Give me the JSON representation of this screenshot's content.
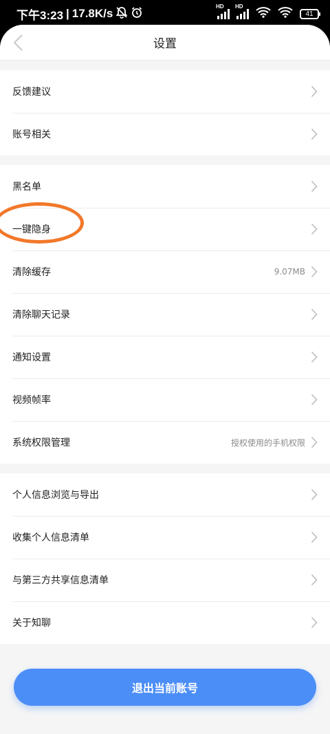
{
  "status_bar": {
    "time": "下午3:23",
    "separator": "|",
    "speed": "17.8K/s",
    "signal_badge": "HD",
    "battery": "41"
  },
  "header": {
    "title": "设置"
  },
  "groups": [
    {
      "items": [
        {
          "label": "反馈建议",
          "value": ""
        },
        {
          "label": "账号相关",
          "value": ""
        }
      ]
    },
    {
      "items": [
        {
          "label": "黑名单",
          "value": ""
        },
        {
          "label": "一键隐身",
          "value": ""
        },
        {
          "label": "清除缓存",
          "value": "9.07MB"
        },
        {
          "label": "清除聊天记录",
          "value": ""
        },
        {
          "label": "通知设置",
          "value": ""
        },
        {
          "label": "视频帧率",
          "value": ""
        },
        {
          "label": "系统权限管理",
          "value": "授权使用的手机权限"
        }
      ]
    },
    {
      "items": [
        {
          "label": "个人信息浏览与导出",
          "value": ""
        },
        {
          "label": "收集个人信息清单",
          "value": ""
        },
        {
          "label": "与第三方共享信息清单",
          "value": ""
        },
        {
          "label": "关于知聊",
          "value": ""
        }
      ]
    }
  ],
  "logout_button": {
    "label": "退出当前账号"
  },
  "colors": {
    "accent": "#4c8ef7",
    "highlight_circle": "#f2782a"
  }
}
